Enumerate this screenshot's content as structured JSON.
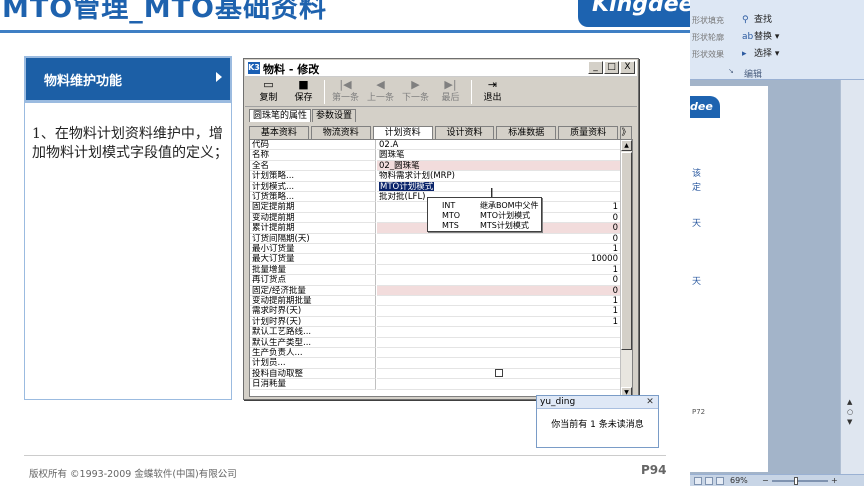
{
  "slide": {
    "title": "MTO管理_MTO基础资料",
    "logo": "Kingdee",
    "feature_label": "物料维护功能",
    "description": "1、在物料计划资料维护中，增加物料计划模式字段值的定义；",
    "copyright": "版权所有 ©1993-2009 金蝶软件(中国)有限公司",
    "page": "P94"
  },
  "window": {
    "title": "物料 - 修改",
    "icon": "K3",
    "buttons": [
      "_",
      "□",
      "X"
    ],
    "toolbar": [
      {
        "label": "复制",
        "icon": "copy-icon",
        "glyph": "▭",
        "enabled": true
      },
      {
        "label": "保存",
        "icon": "save-icon",
        "glyph": "■",
        "enabled": true
      },
      {
        "label": "第一条",
        "icon": "first-record-icon",
        "glyph": "|◀",
        "enabled": false
      },
      {
        "label": "上一条",
        "icon": "prev-record-icon",
        "glyph": "◀",
        "enabled": false
      },
      {
        "label": "下一条",
        "icon": "next-record-icon",
        "glyph": "▶",
        "enabled": false
      },
      {
        "label": "最后",
        "icon": "last-record-icon",
        "glyph": "▶|",
        "enabled": false
      },
      {
        "label": "退出",
        "icon": "exit-icon",
        "glyph": "⇥",
        "enabled": true
      }
    ],
    "subtabs": [
      "圆珠笔的属性",
      "参数设置"
    ],
    "active_subtab": 0,
    "tabs": [
      "基本资料",
      "物流资料",
      "计划资料",
      "设计资料",
      "标准数据",
      "质量资料",
      "》"
    ],
    "active_tab": 2,
    "rows": [
      {
        "label": "代码",
        "value": "02.A",
        "style": ""
      },
      {
        "label": "名称",
        "value": "圆珠笔",
        "style": ""
      },
      {
        "label": "全名",
        "value": "02_圆珠笔",
        "style": "pink"
      },
      {
        "label": "计划策略...",
        "value": "物料需求计划(MRP)",
        "style": ""
      },
      {
        "label": "计划模式...",
        "value": "MTO计划模式",
        "style": "selected"
      },
      {
        "label": "订货策略...",
        "value": "批对批(LFL)",
        "style": ""
      },
      {
        "label": "固定提前期",
        "value": "1",
        "style": "num"
      },
      {
        "label": "变动提前期",
        "value": "0",
        "style": "num"
      },
      {
        "label": "累计提前期",
        "value": "0",
        "style": "num pink"
      },
      {
        "label": "订货间隔期(天)",
        "value": "0",
        "style": "num"
      },
      {
        "label": "最小订货量",
        "value": "1",
        "style": "num"
      },
      {
        "label": "最大订货量",
        "value": "10000",
        "style": "num"
      },
      {
        "label": "批量增量",
        "value": "1",
        "style": "num"
      },
      {
        "label": "再订货点",
        "value": "0",
        "style": "num"
      },
      {
        "label": "固定/经济批量",
        "value": "0",
        "style": "num pink"
      },
      {
        "label": "变动提前期批量",
        "value": "1",
        "style": "num"
      },
      {
        "label": "需求时界(天)",
        "value": "1",
        "style": "num"
      },
      {
        "label": "计划时界(天)",
        "value": "1",
        "style": "num"
      },
      {
        "label": "默认工艺路线...",
        "value": "",
        "style": ""
      },
      {
        "label": "默认生产类型...",
        "value": "",
        "style": ""
      },
      {
        "label": "生产负责人...",
        "value": "",
        "style": ""
      },
      {
        "label": "计划员...",
        "value": "",
        "style": ""
      },
      {
        "label": "投料自动取整",
        "value": "",
        "style": "checkbox"
      },
      {
        "label": "日消耗量",
        "value": "",
        "style": ""
      }
    ],
    "dropdown": [
      {
        "code": "INT",
        "desc": "继承BOM中父件"
      },
      {
        "code": "MTO",
        "desc": "MTO计划模式"
      },
      {
        "code": "MTS",
        "desc": "MTS计划模式"
      }
    ]
  },
  "notification": {
    "user": "yu_ding",
    "message": "你当前有 1 条未读消息"
  },
  "background_app": {
    "ribbon_left": [
      "形状填充",
      "形状轮廓",
      "形状效果"
    ],
    "ribbon_right": [
      {
        "label": "查找",
        "icon": "find-icon",
        "glyph": "⚲",
        "arrow": ""
      },
      {
        "label": "替换",
        "icon": "replace-icon",
        "glyph": "ab",
        "arrow": "▾"
      },
      {
        "label": "选择",
        "icon": "select-icon",
        "glyph": "▸",
        "arrow": "▾"
      }
    ],
    "group_label": "编辑",
    "mini_logo": "dee",
    "mini_text": [
      "该",
      "定",
      "",
      "天"
    ],
    "mini_page": "P72",
    "zoom": "69%"
  }
}
